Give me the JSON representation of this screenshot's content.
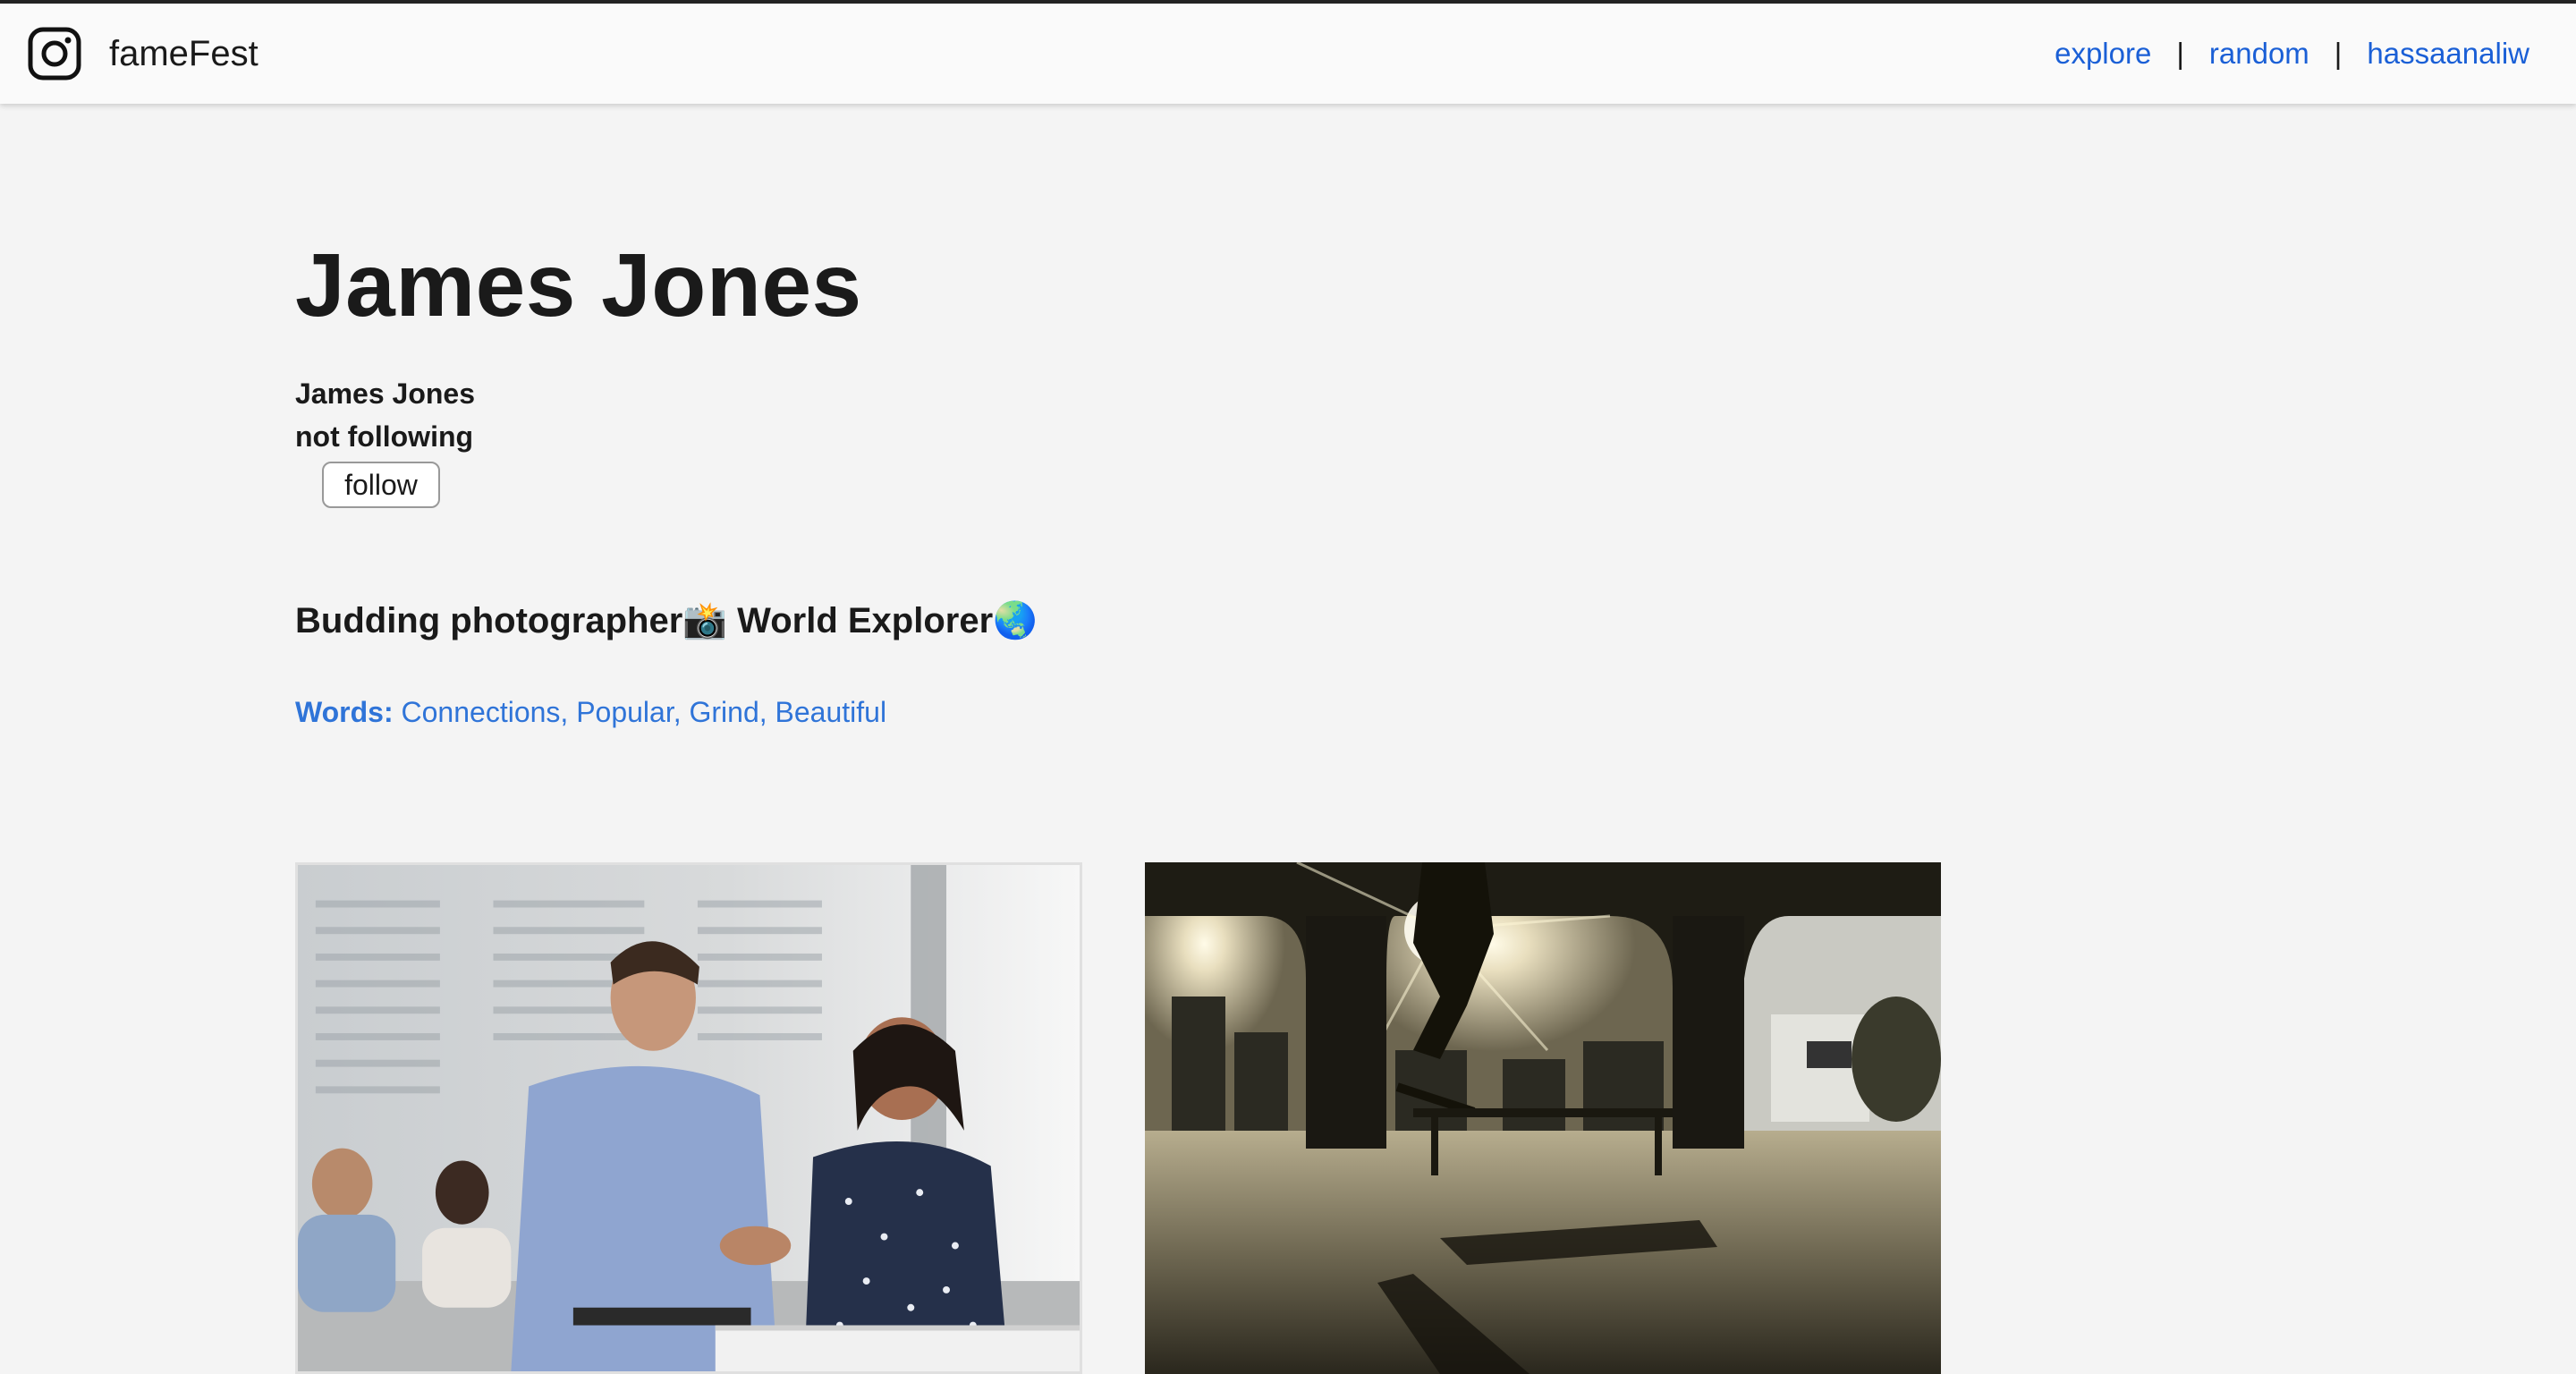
{
  "header": {
    "brand": "fameFest",
    "nav": {
      "explore": "explore",
      "random": "random",
      "user": "hassaanaliw",
      "separator": "|"
    }
  },
  "profile": {
    "title": "James Jones",
    "name": "James Jones",
    "follow_status": "not following",
    "follow_button": "follow",
    "bio": "Budding photographer📸 World Explorer🌏",
    "words_label": "Words:",
    "words": "Connections, Popular, Grind, Beautiful"
  },
  "posts": [
    {
      "description": "office handshake photo"
    },
    {
      "description": "skateboarder silhouette photo"
    }
  ],
  "colors": {
    "link": "#1a5fd6",
    "words": "#2f74d8",
    "background": "#f4f4f4"
  }
}
